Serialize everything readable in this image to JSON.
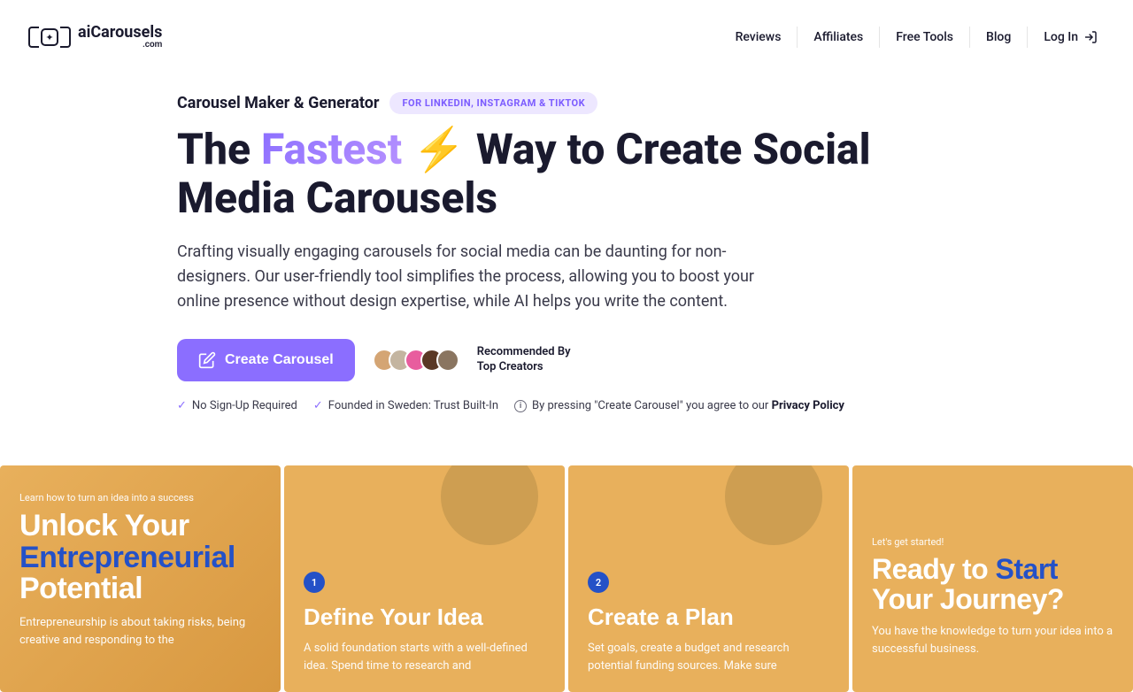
{
  "logo": {
    "main": "aiCarousels",
    "sub": ".com"
  },
  "nav": {
    "reviews": "Reviews",
    "affiliates": "Affiliates",
    "freetools": "Free Tools",
    "blog": "Blog",
    "login": "Log In"
  },
  "hero": {
    "label": "Carousel Maker & Generator",
    "badge": "FOR LINKEDIN, INSTAGRAM & TIKTOK",
    "title_pre": "The ",
    "title_fastest": "Fastest",
    "title_bolt": "⚡",
    "title_post": " Way to Create Social Media Carousels",
    "desc": "Crafting visually engaging carousels for social media can be daunting for non-designers. Our user-friendly tool simplifies the process, allowing you to boost your online presence without design expertise, while AI helps you write the content.",
    "cta": "Create Carousel",
    "recommended_l1": "Recommended By",
    "recommended_l2": "Top Creators",
    "meta1": "No Sign-Up Required",
    "meta2": "Founded in Sweden: Trust Built-In",
    "meta3_pre": "By pressing \"Create Carousel\" you agree to our ",
    "meta3_link": "Privacy Policy"
  },
  "slides": {
    "s1": {
      "sub": "Learn how to turn an idea into a success",
      "l1": "Unlock Your",
      "l2": "Entrepreneurial",
      "l3": "Potential",
      "p": "Entrepreneurship is about taking risks, being creative and responding to the"
    },
    "s2": {
      "num": "1",
      "h": "Define Your Idea",
      "p": "A solid foundation starts with a well-defined idea. Spend time to research and"
    },
    "s3": {
      "num": "2",
      "h": "Create a Plan",
      "p": "Set goals, create a budget and research potential funding sources. Make sure"
    },
    "s4": {
      "sub": "Let's get started!",
      "l1": "Ready to ",
      "l1b": "Start",
      "l2": "Your Journey?",
      "p": "You have the knowledge to turn your idea into a successful business."
    }
  }
}
